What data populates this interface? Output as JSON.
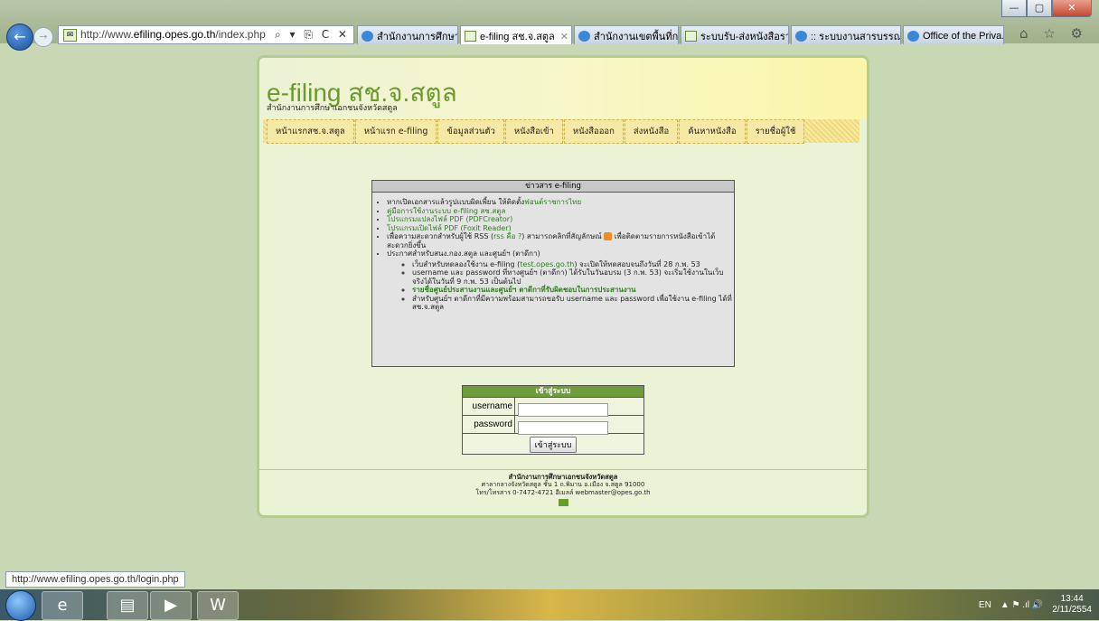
{
  "browser": {
    "address_url_prefix": "http://www.",
    "address_url_host": "efiling.opes.go.th",
    "address_url_suffix": "/index.php",
    "address_controls": "⌕ ▾ ⎘ C ✕",
    "tabs": [
      {
        "label": "สำนักงานการศึกษาร...",
        "icon": "ie-icon",
        "active": false,
        "closable": false
      },
      {
        "label": "e-filing สช.จ.สตูล",
        "icon": "mail-icon",
        "active": true,
        "closable": true
      },
      {
        "label": "สำนักงานเขตพื้นที่กา...",
        "icon": "ie-icon",
        "active": false,
        "closable": false
      },
      {
        "label": "ระบบรับ-ส่งหนังสือรา...",
        "icon": "mail-icon",
        "active": false,
        "closable": false
      },
      {
        "label": ":: ระบบงานสารบรรณ...",
        "icon": "ie-icon",
        "active": false,
        "closable": false
      },
      {
        "label": "Office of the Priva...",
        "icon": "ie-icon",
        "active": false,
        "closable": false
      }
    ],
    "tab_close": "✕",
    "nav_icons": "⌂ ☆ ⚙",
    "window_controls": {
      "minimize": "—",
      "maximize": "▢",
      "close": "✕"
    },
    "back": "←",
    "forward": "→",
    "status_url": "http://www.efiling.opes.go.th/login.php"
  },
  "header": {
    "title": "e-filing สช.จ.สตูล",
    "subtitle": "สำนักงานการศึกษาเอกชนจังหวัดสตูล"
  },
  "menu": [
    "หน้าแรกสช.จ.สตูล",
    "หน้าแรก e-filing",
    "ข้อมูลส่วนตัว",
    "หนังสือเข้า",
    "หนังสือออก",
    "ส่งหนังสือ",
    "ค้นหาหนังสือ",
    "รายชื่อผู้ใช้"
  ],
  "news": {
    "heading": "ข่าวสาร e-filing",
    "item1_text": "หากเปิดเอกสารแล้วรูปแบบผิดเพี้ยน ให้ติดตั้ง",
    "item1_link": "ฟอนต์ราชการไทย",
    "item2_link": "คู่มือการใช้งานระบบ e-filing สช.สตูล",
    "item3_link": "โปรแกรมแปลงไฟล์ PDF (PDFCreator)",
    "item4_link": "โปรแกรมเปิดไฟล์ PDF (Foxit Reader)",
    "item5_a": "เพื่อความสะดวกสำหรับผู้ใช้ RSS (",
    "item5_link": "rss คือ ?",
    "item5_b": ") สามารถคลิกที่สัญลักษณ์",
    "item5_c": "เพื่อติดตามรายการหนังสือเข้าได้สะดวกยิ่งขึ้น",
    "item6": "ประกาศสำหรับสนง.กอง.สตูล และศูนย์ฯ (ตาดีกา)",
    "sub1_a": "เว็บสำหรับทดลองใช้งาน e-filing (",
    "sub1_link": "test.opes.go.th",
    "sub1_b": ") จะเปิดให้ทดสอบจนถึงวันที่ 28 ก.พ. 53",
    "sub2": "username และ password ที่ทางศูนย์ฯ (ตาดีกา) ได้รับในวันอบรม (3 ก.พ. 53) จะเริ่มใช้งานในเว็บจริงได้ในวันที่ 9 ก.พ. 53 เป็นต้นไป",
    "sub3_link": "รายชื่อศูนย์ประสานงานและศูนย์ฯ ตาดีกาที่รับผิดชอบในการประสานงาน",
    "sub4": "สำหรับศูนย์ฯ ตาดีกาที่มีความพร้อมสามารถขอรับ username และ password เพื่อใช้งาน e-filing ได้ที่ สช.จ.สตูล"
  },
  "login": {
    "heading": "เข้าสู่ระบบ",
    "username_label": "username",
    "password_label": "password",
    "username_value": "",
    "password_value": "",
    "submit": "เข้าสู่ระบบ"
  },
  "footer": {
    "name": "สำนักงานการศึกษาเอกชนจังหวัดสตูล",
    "address": "ศาลากลางจังหวัดสตูล ชั้น 1 ถ.พิมาน อ.เมือง จ.สตูล 91000",
    "contact": "โทร/โทรสาร 0-7472-4721 อีเมลล์ webmaster@opes.go.th"
  },
  "taskbar": {
    "lang": "EN",
    "time": "13:44",
    "date": "2/11/2554",
    "tray_icons": "▲ ⚑ .ıl 🔊",
    "apps": [
      "ie-icon",
      "explorer-icon",
      "media-player-icon",
      "word-icon"
    ],
    "app_glyphs": [
      "e",
      "▤",
      "▶",
      "W"
    ]
  }
}
